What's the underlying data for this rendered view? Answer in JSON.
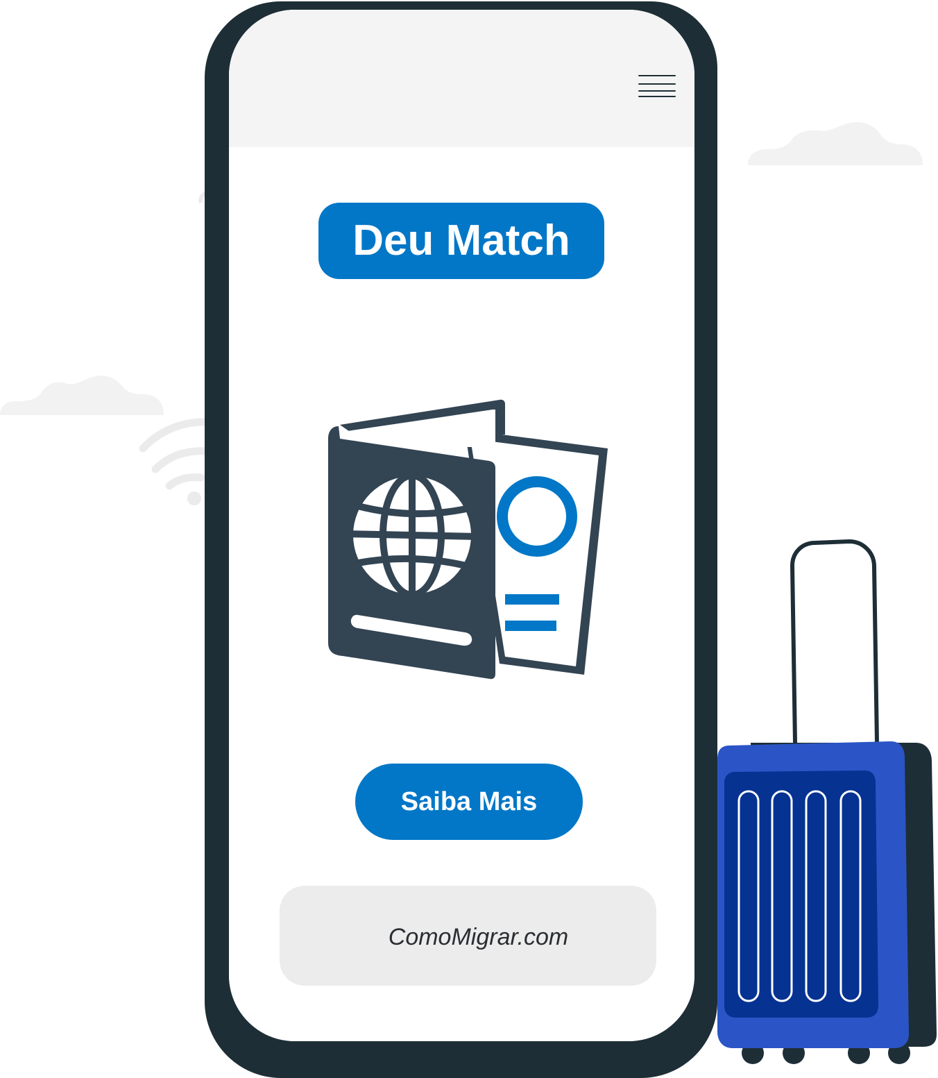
{
  "screen": {
    "title": "Deu Match",
    "cta_label": "Saiba Mais",
    "footer_text": "ComoMigrar.com"
  },
  "icons": {
    "menu": "hamburger-menu-icon",
    "documents": "passport-and-visa-icon",
    "luggage": "suitcase-icon",
    "signal": "wifi-icon"
  },
  "colors": {
    "accent": "#0277c7",
    "phone_frame": "#1e2e36",
    "passport": "#334453",
    "suitcase": "#2b55c6",
    "suitcase_panel": "#063292",
    "screen_header": "#f4f4f4",
    "footer_box": "#ececec",
    "cloud": "#f2f2f2"
  }
}
